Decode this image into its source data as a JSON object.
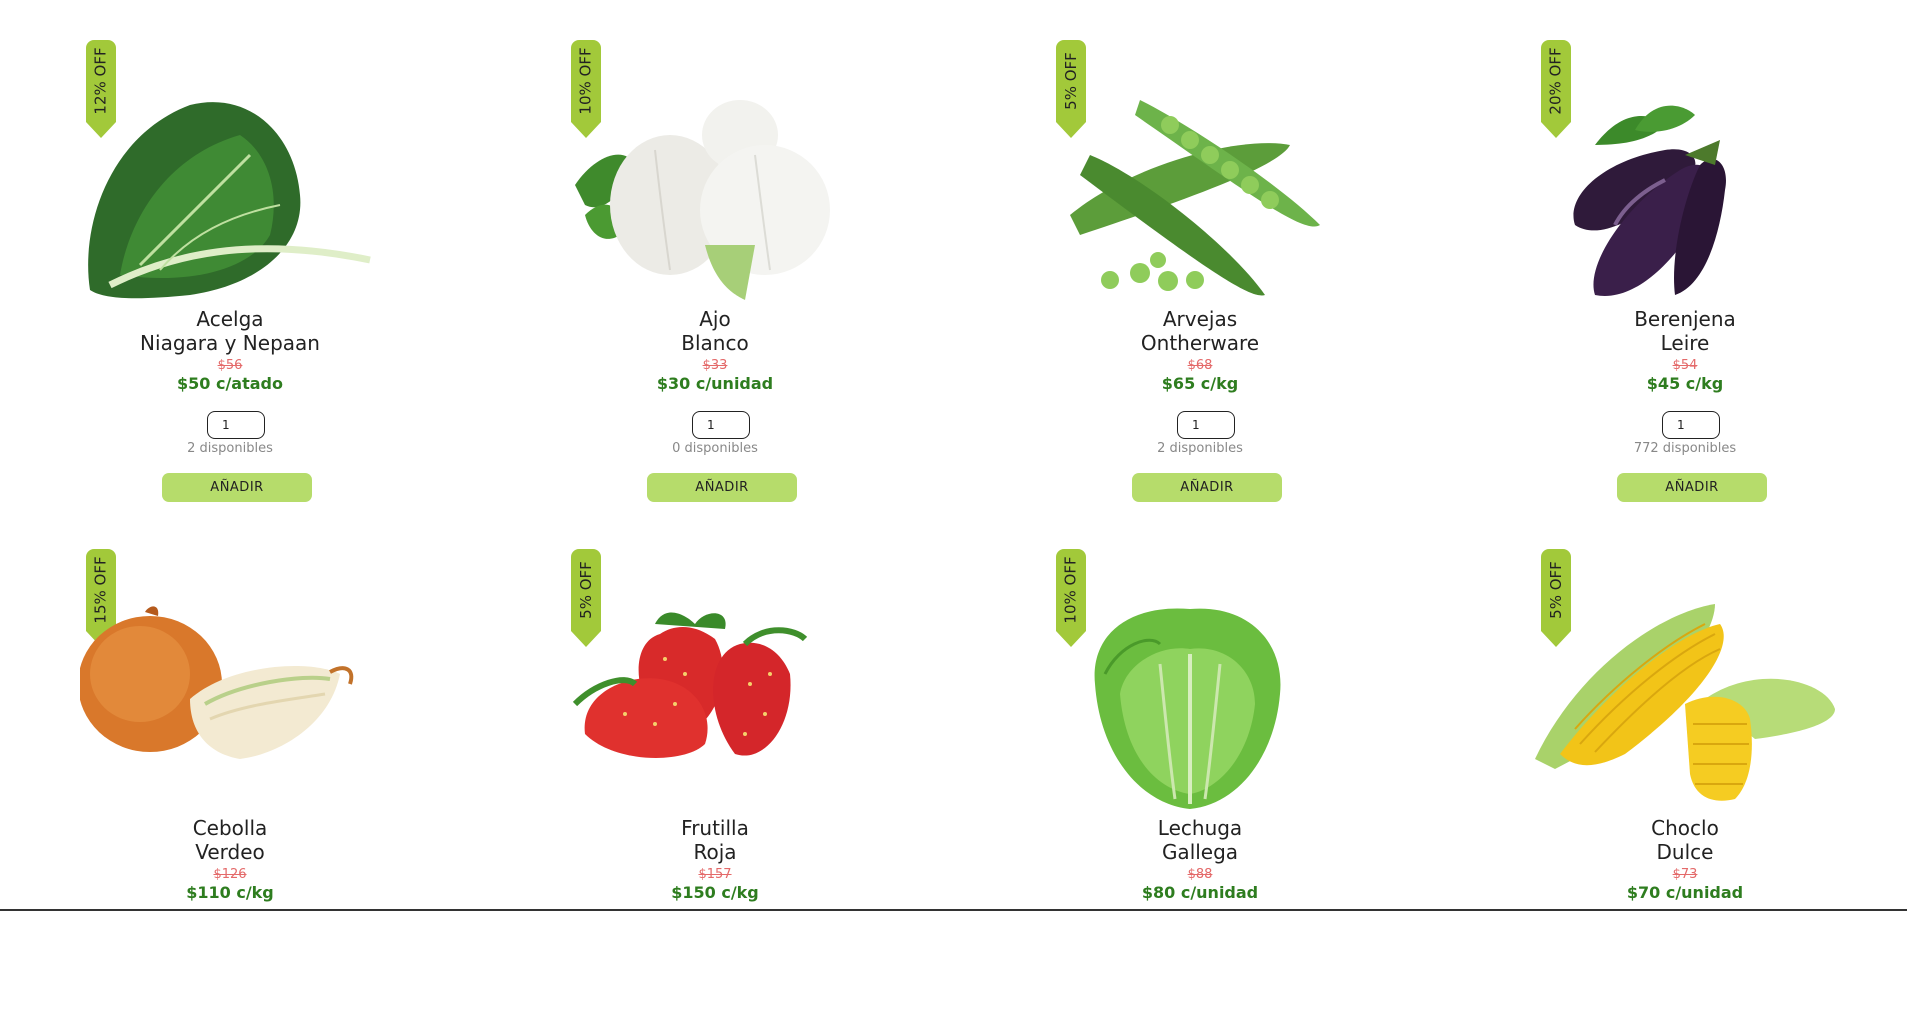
{
  "products": [
    {
      "discount": "12% OFF",
      "name": "Acelga",
      "variety": "Niagara y Nepaan",
      "old_price": "$56",
      "price": "$50 c/atado",
      "quantity": "1",
      "available": "2 disponibles",
      "add_label": "AÑADIR",
      "image": "chard"
    },
    {
      "discount": "10% OFF",
      "name": "Ajo",
      "variety": "Blanco",
      "old_price": "$33",
      "price": "$30 c/unidad",
      "quantity": "1",
      "available": "0 disponibles",
      "add_label": "AÑADIR",
      "image": "garlic"
    },
    {
      "discount": "5% OFF",
      "name": "Arvejas",
      "variety": "Ontherware",
      "old_price": "$68",
      "price": "$65 c/kg",
      "quantity": "1",
      "available": "2 disponibles",
      "add_label": "AÑADIR",
      "image": "peas"
    },
    {
      "discount": "20% OFF",
      "name": "Berenjena",
      "variety": "Leire",
      "old_price": "$54",
      "price": "$45 c/kg",
      "quantity": "1",
      "available": "772 disponibles",
      "add_label": "AÑADIR",
      "image": "eggplant"
    },
    {
      "discount": "15% OFF",
      "name": "Cebolla",
      "variety": "Verdeo",
      "old_price": "$126",
      "price": "$110 c/kg",
      "image": "onion"
    },
    {
      "discount": "5% OFF",
      "name": "Frutilla",
      "variety": "Roja",
      "old_price": "$157",
      "price": "$150 c/kg",
      "image": "strawberry"
    },
    {
      "discount": "10% OFF",
      "name": "Lechuga",
      "variety": "Gallega",
      "old_price": "$88",
      "price": "$80 c/unidad",
      "image": "lettuce"
    },
    {
      "discount": "5% OFF",
      "name": "Choclo",
      "variety": "Dulce",
      "old_price": "$73",
      "price": "$70 c/unidad",
      "image": "corn"
    }
  ],
  "colors": {
    "badge": "#a2c93a",
    "button": "#b6dc6b",
    "price": "#2e7d1f",
    "old_price": "#e46a6a"
  }
}
